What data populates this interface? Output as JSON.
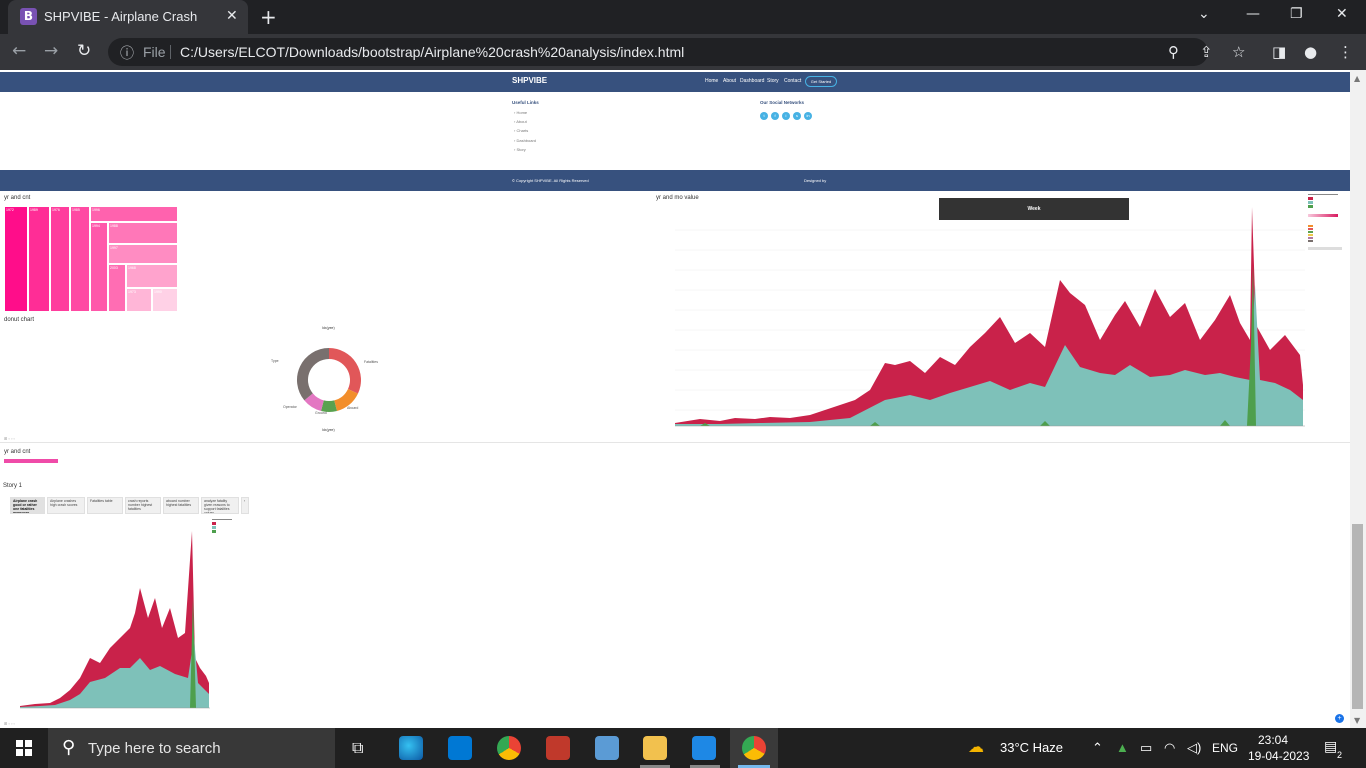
{
  "browser": {
    "tab_title": "SHPVIBE - Airplane Crash",
    "favicon_letter": "B",
    "file_label": "File",
    "url": "C:/Users/ELCOT/Downloads/bootstrap/Airplane%20crash%20analysis/index.html"
  },
  "site": {
    "logo": "SHPVIBE",
    "nav": [
      "Home",
      "About",
      "Dashboard",
      "Story",
      "Contact"
    ],
    "cta": "Get Started",
    "footer": {
      "links_title": "Useful Links",
      "links": [
        "Home",
        "About",
        "Charts",
        "Dashboard",
        "Story"
      ],
      "social_title": "Our Social Networks",
      "copyright": "© Copyright SHPVIBE. All Rights Reserved",
      "designed_by": "Designed by"
    }
  },
  "dashboard": {
    "treemap_title": "yr and cnt",
    "area_title": "yr and mo value",
    "donut_title": "donut chart",
    "dark_banner": "Week",
    "treemap_labels": [
      "1972",
      "1989",
      "1976",
      "1985",
      "1996",
      "1994",
      "1988",
      "1997",
      "2003",
      "1968",
      "1973",
      "1990",
      "1951",
      "1979",
      "1970",
      "1954",
      "2007",
      "1999",
      "1956",
      "1949",
      "1984",
      "1998"
    ],
    "donut": {
      "top_label": "Idx(yee)",
      "bottom_label": "Idx(yee)",
      "slices": [
        {
          "name": "Fatalities",
          "value": 32,
          "color": "#e15759"
        },
        {
          "name": "Aboard",
          "value": 14,
          "color": "#f28e2b"
        },
        {
          "name": "Ground",
          "value": 8,
          "color": "#59a14f"
        },
        {
          "name": "Operator",
          "value": 10,
          "color": "#e377c2"
        },
        {
          "name": "Type",
          "value": 36,
          "color": "#79706e"
        }
      ]
    }
  },
  "story": {
    "mini_title": "yr and cnt",
    "title": "Story 1",
    "tabs": [
      "Airplane crash good or rather one fatalities measures",
      "Airplane crashes high crash scores",
      "Fatalities table",
      "crash reports number highest fatalities",
      "aboard number highest fatalities",
      "analyze fatality given reasons to support fatalities values"
    ]
  },
  "taskbar": {
    "search_placeholder": "Type here to search",
    "weather": "33°C  Haze",
    "language": "ENG",
    "time": "23:04",
    "date": "19-04-2023",
    "notification_count": "2"
  }
}
